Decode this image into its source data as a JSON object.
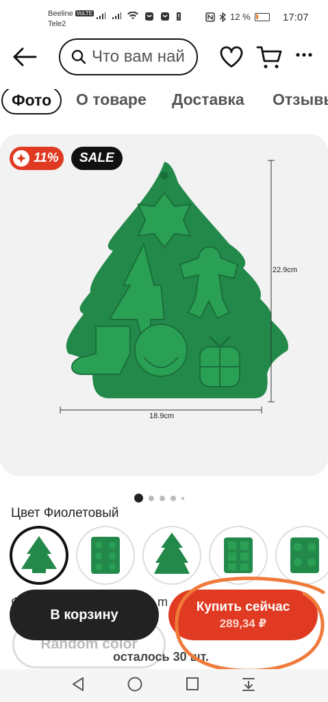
{
  "status_bar": {
    "carrier1": "Beeline",
    "volte": "VoLTE",
    "carrier2": "Tele2",
    "battery": "12 %",
    "time": "17:07"
  },
  "header": {
    "search_placeholder": "Что вам най",
    "icons": [
      "back-arrow-icon",
      "search-icon",
      "heart-icon",
      "cart-icon",
      "more-icon"
    ]
  },
  "tabs": [
    {
      "label": "Фото",
      "active": true
    },
    {
      "label": "О товаре",
      "active": false
    },
    {
      "label": "Доставка",
      "active": false
    },
    {
      "label": "Отзывы",
      "active": false
    }
  ],
  "product_image": {
    "discount": "11%",
    "sale": "SALE",
    "height_label": "22.9cm",
    "width_label": "18.9cm",
    "mold_color": "#23894a"
  },
  "carousel": {
    "count": 5,
    "active": 0
  },
  "color": {
    "label": "Цвет Фиолетовый",
    "options_count": 5,
    "selected": 0
  },
  "hidden_row_text": "Ф",
  "hidden_row_tail": "m",
  "random_color": "Random color",
  "stock": "осталось 30 шт.",
  "buttons": {
    "cart": "В корзину",
    "buy": "Купить сейчас",
    "price": "289,34 ₽"
  },
  "colors": {
    "accent": "#e03a22",
    "dark": "#222222",
    "annotation": "#f07a3a"
  }
}
